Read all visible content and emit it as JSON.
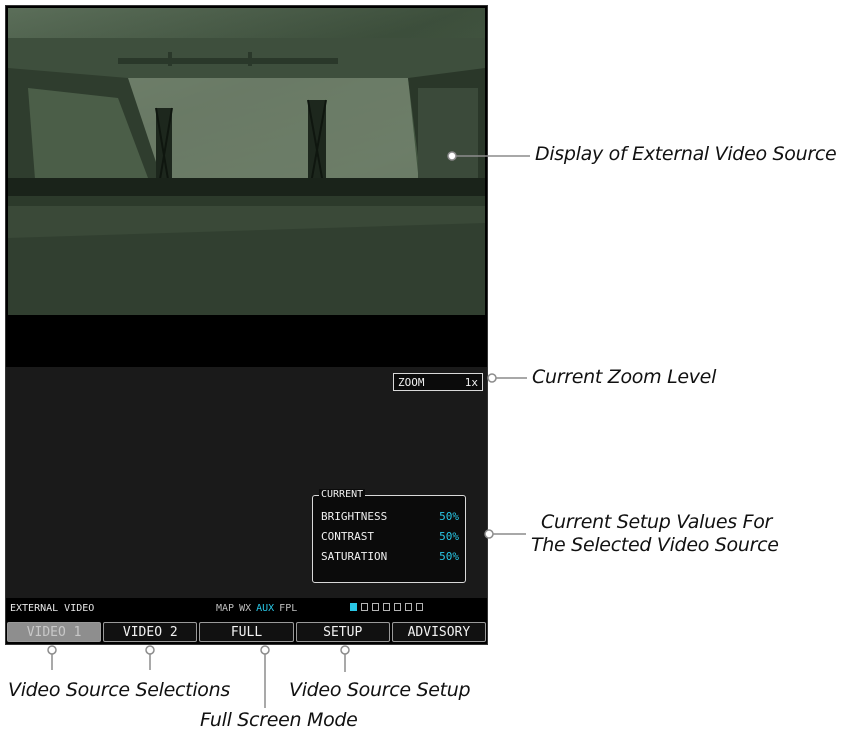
{
  "screen": {
    "zoom": {
      "label": "ZOOM",
      "value": "1x"
    },
    "current_setup": {
      "title": "CURRENT",
      "rows": [
        {
          "label": "BRIGHTNESS",
          "value": "50%"
        },
        {
          "label": "CONTRAST",
          "value": "50%"
        },
        {
          "label": "SATURATION",
          "value": "50%"
        }
      ]
    },
    "status_bar": {
      "page_title": "EXTERNAL VIDEO",
      "page_groups": [
        "MAP",
        "WX",
        "AUX",
        "FPL"
      ],
      "active_group": "AUX"
    },
    "softkeys": [
      "VIDEO 1",
      "VIDEO 2",
      "FULL",
      "SETUP",
      "ADVISORY"
    ],
    "selected_softkey": "VIDEO 1"
  },
  "callouts": {
    "video_display": "Display of External Video Source",
    "zoom_level": "Current Zoom Level",
    "setup_values_line1": "Current Setup Values For",
    "setup_values_line2": "The Selected Video Source",
    "source_selections": "Video Source Selections",
    "source_setup": "Video Source Setup",
    "full_screen": "Full Screen Mode"
  },
  "colors": {
    "active_cyan": "#29c7e6",
    "video_tint": "#4c6049"
  }
}
